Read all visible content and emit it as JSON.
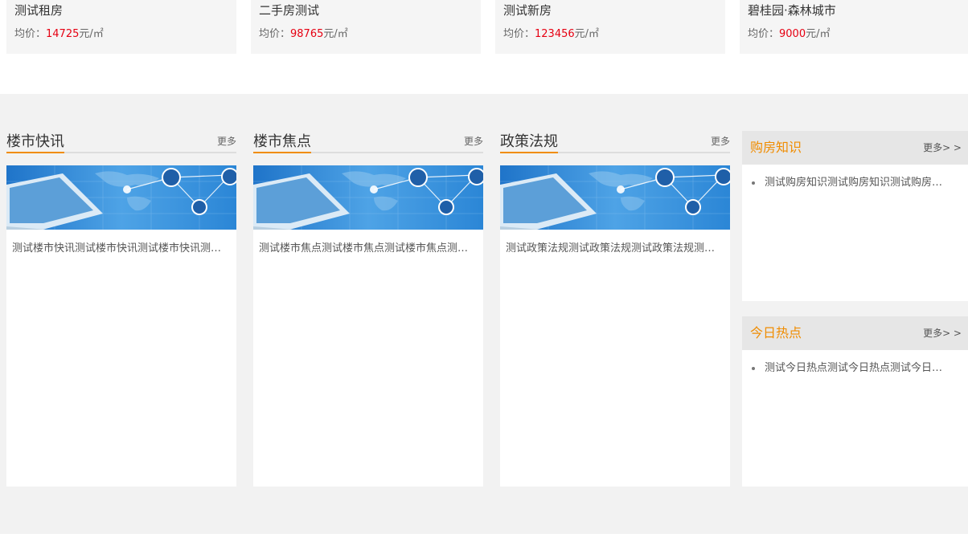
{
  "properties": [
    {
      "name": "测试租房",
      "price_label": "均价：",
      "price_value": "14725",
      "price_unit": "元/㎡"
    },
    {
      "name": "二手房测试",
      "price_label": "均价：",
      "price_value": "98765",
      "price_unit": "元/㎡"
    },
    {
      "name": "测试新房",
      "price_label": "均价：",
      "price_value": "123456",
      "price_unit": "元/㎡"
    },
    {
      "name": "碧桂园·森林城市",
      "price_label": "均价：",
      "price_value": "9000",
      "price_unit": "元/㎡"
    }
  ],
  "news_columns": [
    {
      "title": "楼市快讯",
      "more_label": "更多",
      "article": "测试楼市快讯测试楼市快讯测试楼市快讯测试楼市快讯"
    },
    {
      "title": "楼市焦点",
      "more_label": "更多",
      "article": "测试楼市焦点测试楼市焦点测试楼市焦点测试楼市焦点"
    },
    {
      "title": "政策法规",
      "more_label": "更多",
      "article": "测试政策法规测试政策法规测试政策法规测试政策法规"
    }
  ],
  "side_panels": [
    {
      "title": "购房知识",
      "more_label": "更多> >",
      "items": [
        "测试购房知识测试购房知识测试购房知识测试购房知识"
      ]
    },
    {
      "title": "今日热点",
      "more_label": "更多> >",
      "items": [
        "测试今日热点测试今日热点测试今日热点测试今日热点"
      ]
    }
  ],
  "colors": {
    "accent": "#f08c00",
    "price": "#e60012",
    "band_background": "#f2f2f2",
    "card_background": "#f5f5f5"
  },
  "icons": {
    "news_image": "laptop-network-globe-image"
  }
}
